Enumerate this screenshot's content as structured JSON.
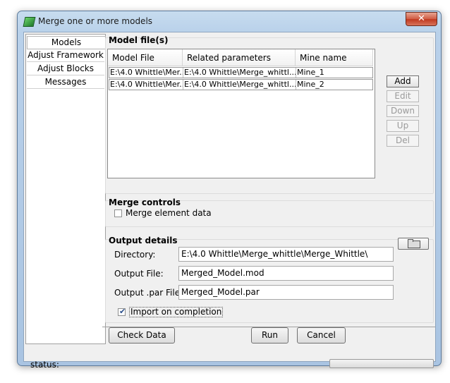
{
  "window": {
    "title": "Merge one or more models",
    "close_glyph": "✕"
  },
  "nav": {
    "items": [
      "Models",
      "Adjust Framework",
      "Adjust Blocks",
      "Messages"
    ]
  },
  "model_files": {
    "title": "Model file(s)",
    "columns": [
      "Model File",
      "Related parameters",
      "Mine name"
    ],
    "rows": [
      [
        "E:\\4.0 Whittle\\Mer...",
        "E:\\4.0 Whittle\\Merge_whittl...",
        "Mine_1"
      ],
      [
        "E:\\4.0 Whittle\\Mer...",
        "E:\\4.0 Whittle\\Merge_whittl...",
        "Mine_2"
      ]
    ],
    "buttons": {
      "add": "Add",
      "edit": "Edit",
      "down": "Down",
      "up": "Up",
      "del": "Del"
    }
  },
  "merge_controls": {
    "title": "Merge controls",
    "merge_element_label": "Merge element data",
    "merge_element_checked": false
  },
  "output": {
    "title": "Output details",
    "directory_label": "Directory:",
    "directory_value": "E:\\4.0 Whittle\\Merge_whittle\\Merge_Whittle\\",
    "output_file_label": "Output File:",
    "output_file_value": "Merged_Model.mod",
    "par_file_label": "Output .par File:",
    "par_file_value": "Merged_Model.par",
    "import_label": "Import on completion",
    "import_checked": true
  },
  "footer": {
    "check_data": "Check Data",
    "run": "Run",
    "cancel": "Cancel",
    "status": "status:"
  },
  "icons": {
    "app": "app-icon",
    "folder": "folder-icon",
    "check": "checkmark-icon"
  }
}
